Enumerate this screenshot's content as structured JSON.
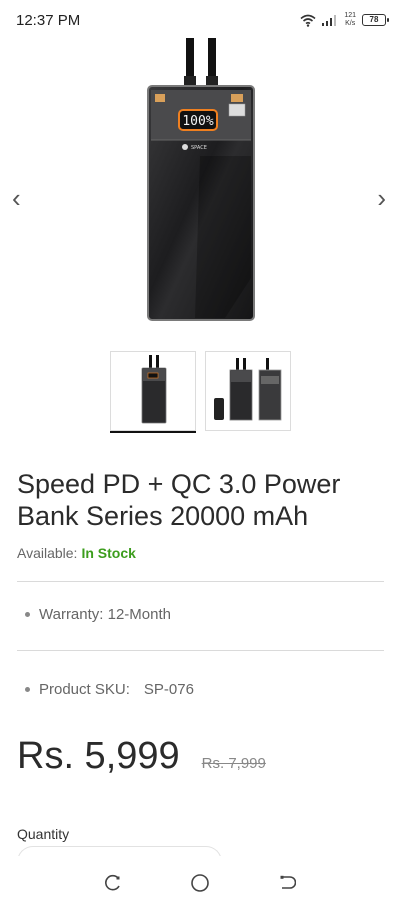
{
  "status": {
    "time": "12:37 PM",
    "net_speed_value": "121",
    "net_speed_unit": "K/s",
    "battery": "78"
  },
  "gallery": {
    "brand": "SPACE",
    "display": "100%"
  },
  "product": {
    "title": "Speed PD + QC 3.0 Power Bank Series 20000 mAh",
    "availability_label": "Available:",
    "availability_value": "In Stock",
    "warranty": "Warranty: 12-Month",
    "sku_label": "Product SKU:",
    "sku_value": "SP-076",
    "price": "Rs. 5,999",
    "old_price": "Rs. 7,999",
    "quantity_label": "Quantity"
  },
  "colors": {
    "in_stock": "#3c9d1d",
    "text": "#2b2b2b",
    "muted": "#666666"
  },
  "icons": [
    "wifi-icon",
    "signal-icon",
    "battery-icon",
    "chevron-left-icon",
    "chevron-right-icon",
    "recent-apps-icon",
    "home-icon",
    "back-icon"
  ]
}
